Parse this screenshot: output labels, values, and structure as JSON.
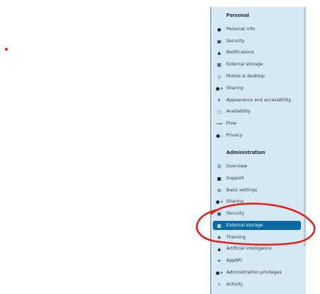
{
  "personal": {
    "heading": "Personal",
    "items": [
      {
        "label": "Personal info",
        "icon": "person-icon"
      },
      {
        "label": "Security",
        "icon": "lock-icon"
      },
      {
        "label": "Notifications",
        "icon": "bell-icon"
      },
      {
        "label": "External storage",
        "icon": "external-storage-icon"
      },
      {
        "label": "Mobile & desktop",
        "icon": "phone-icon"
      },
      {
        "label": "Sharing",
        "icon": "share-icon"
      },
      {
        "label": "Appearance and accessibility",
        "icon": "accessibility-icon"
      },
      {
        "label": "Availability",
        "icon": "clock-icon"
      },
      {
        "label": "Flow",
        "icon": "flow-icon"
      },
      {
        "label": "Privacy",
        "icon": "key-icon"
      }
    ]
  },
  "administration": {
    "heading": "Administration",
    "items": [
      {
        "label": "Overview",
        "icon": "overview-icon"
      },
      {
        "label": "Support",
        "icon": "chat-icon"
      },
      {
        "label": "Basic settings",
        "icon": "gear-icon"
      },
      {
        "label": "Sharing",
        "icon": "share-icon"
      },
      {
        "label": "Security",
        "icon": "lock-icon"
      },
      {
        "label": "External storage",
        "icon": "external-storage-icon",
        "active": true
      },
      {
        "label": "Theming",
        "icon": "paint-icon"
      },
      {
        "label": "Artificial intelligence",
        "icon": "ai-icon"
      },
      {
        "label": "AppAPI",
        "icon": "app-api-icon"
      },
      {
        "label": "Administration privileges",
        "icon": "admin-icon"
      },
      {
        "label": "Activity",
        "icon": "activity-icon"
      }
    ]
  },
  "colors": {
    "panel_bg": "#d6e8f2",
    "active_bg": "#0b6aa1",
    "annotation": "#e0201b"
  }
}
